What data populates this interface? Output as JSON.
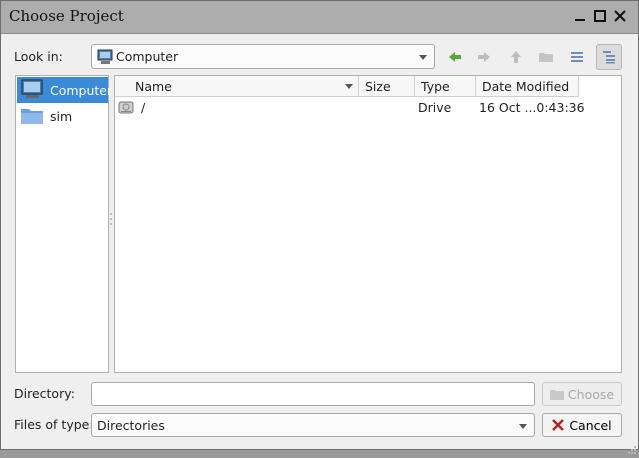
{
  "window": {
    "title": "Choose Project"
  },
  "titlebar_buttons": [
    {
      "name": "minimize-button",
      "glyph": "▁"
    },
    {
      "name": "maximize-button",
      "glyph": "☐"
    },
    {
      "name": "close-button",
      "glyph": "✕"
    }
  ],
  "lookin": {
    "label": "Look in:",
    "value": "Computer",
    "icon": "computer-icon"
  },
  "toolbar": {
    "buttons": [
      {
        "name": "back-button",
        "icon": "arrow-left-icon",
        "enabled": true
      },
      {
        "name": "forward-button",
        "icon": "arrow-right-icon",
        "enabled": false
      },
      {
        "name": "parent-dir-button",
        "icon": "arrow-up-icon",
        "enabled": false
      },
      {
        "name": "new-folder-button",
        "icon": "folder-icon",
        "enabled": false
      },
      {
        "name": "list-view-button",
        "icon": "list-view-icon",
        "enabled": true
      },
      {
        "name": "detail-view-button",
        "icon": "detail-view-icon",
        "enabled": true,
        "active": true
      }
    ]
  },
  "sidebar": {
    "items": [
      {
        "label": "Computer",
        "icon": "computer-icon",
        "selected": true
      },
      {
        "label": "sim",
        "icon": "folder-icon",
        "selected": false
      }
    ]
  },
  "filelist": {
    "columns": [
      "Name",
      "Size",
      "Type",
      "Date Modified"
    ],
    "rows": [
      {
        "name": "/",
        "size": "",
        "type": "Drive",
        "date": "16 Oct ...0:43:36",
        "icon": "drive-icon"
      }
    ]
  },
  "directory": {
    "label": "Directory:",
    "value": "",
    "choose_label": "Choose"
  },
  "filetype": {
    "label": "Files of type:",
    "value": "Directories",
    "cancel_label": "Cancel"
  },
  "colors": {
    "selection": "#3a8ad6",
    "accent_green": "#5aa63a",
    "titlebar": "#adadad"
  }
}
